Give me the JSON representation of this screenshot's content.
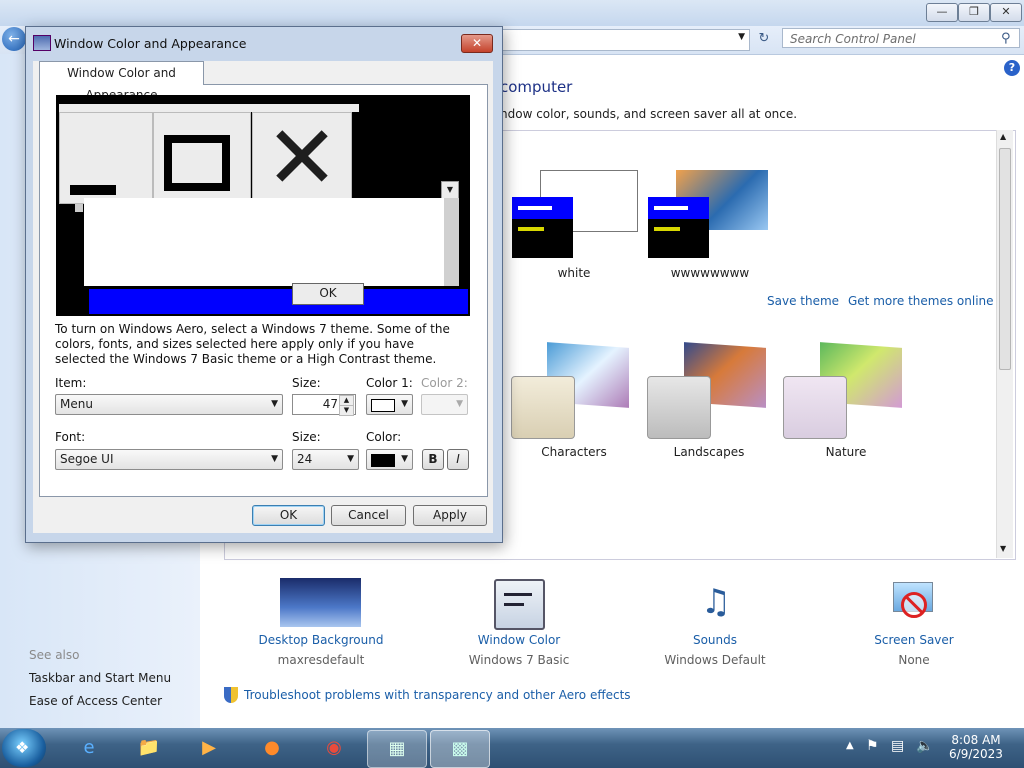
{
  "control_panel": {
    "search_placeholder": "Search Control Panel",
    "heading": "computer",
    "subheading": "ndow color, sounds, and screen saver all at once.",
    "my_themes": [
      {
        "name": "white"
      },
      {
        "name": "wwwwwwww"
      }
    ],
    "save_theme": "Save theme",
    "get_more": "Get more themes online",
    "aero_themes": [
      {
        "name": "Characters"
      },
      {
        "name": "Landscapes"
      },
      {
        "name": "Nature"
      }
    ],
    "bottom_items": [
      {
        "title": "Desktop Background",
        "sub": "maxresdefault"
      },
      {
        "title": "Window Color",
        "sub": "Windows 7 Basic"
      },
      {
        "title": "Sounds",
        "sub": "Windows Default"
      },
      {
        "title": "Screen Saver",
        "sub": "None"
      }
    ],
    "troubleshoot": "Troubleshoot problems with transparency and other Aero effects",
    "see_also": {
      "label": "See also",
      "links": [
        "Taskbar and Start Menu",
        "Ease of Access Center"
      ]
    }
  },
  "dialog": {
    "title": "Window Color and Appearance",
    "tab": "Window Color and Appearance",
    "preview_ok": "OK",
    "info": "To turn on Windows Aero, select a Windows 7 theme.  Some of the colors, fonts, and sizes selected here apply only if you have selected the Windows 7 Basic theme or a High Contrast theme.",
    "item_label": "Item:",
    "item_value": "Menu",
    "size_label": "Size:",
    "size_value": "47",
    "color1_label": "Color 1:",
    "color2_label": "Color 2:",
    "font_label": "Font:",
    "font_value": "Segoe UI",
    "font_size_label": "Size:",
    "font_size_value": "24",
    "font_color_label": "Color:",
    "bold_label": "B",
    "italic_label": "I",
    "ok": "OK",
    "cancel": "Cancel",
    "apply": "Apply"
  },
  "taskbar": {
    "time": "8:08 AM",
    "date": "6/9/2023"
  },
  "colors": {
    "preview_blue": "#0000ff",
    "link": "#1a5ea8"
  }
}
